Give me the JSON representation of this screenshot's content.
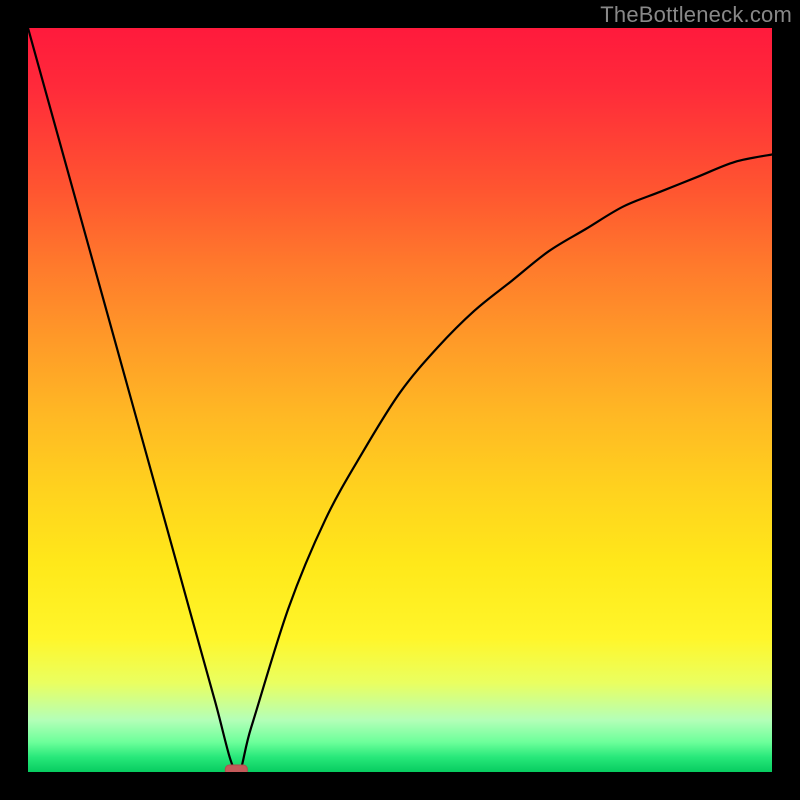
{
  "watermark": "TheBottleneck.com",
  "chart_data": {
    "type": "line",
    "title": "",
    "xlabel": "",
    "ylabel": "",
    "xlim": [
      0,
      100
    ],
    "ylim": [
      0,
      100
    ],
    "background_gradient": {
      "top_color": "#ff1a3c",
      "bottom_color": "#07cc60",
      "meaning": "red high values, green low values"
    },
    "series": [
      {
        "name": "bottleneck-curve",
        "x": [
          0,
          5,
          10,
          15,
          20,
          25,
          28,
          30,
          35,
          40,
          45,
          50,
          55,
          60,
          65,
          70,
          75,
          80,
          85,
          90,
          95,
          100
        ],
        "values": [
          100,
          82,
          64,
          46,
          28,
          10,
          0,
          6,
          22,
          34,
          43,
          51,
          57,
          62,
          66,
          70,
          73,
          76,
          78,
          80,
          82,
          83
        ]
      }
    ],
    "annotations": [
      {
        "name": "minimum-marker",
        "x": 28,
        "y": 0
      }
    ]
  }
}
